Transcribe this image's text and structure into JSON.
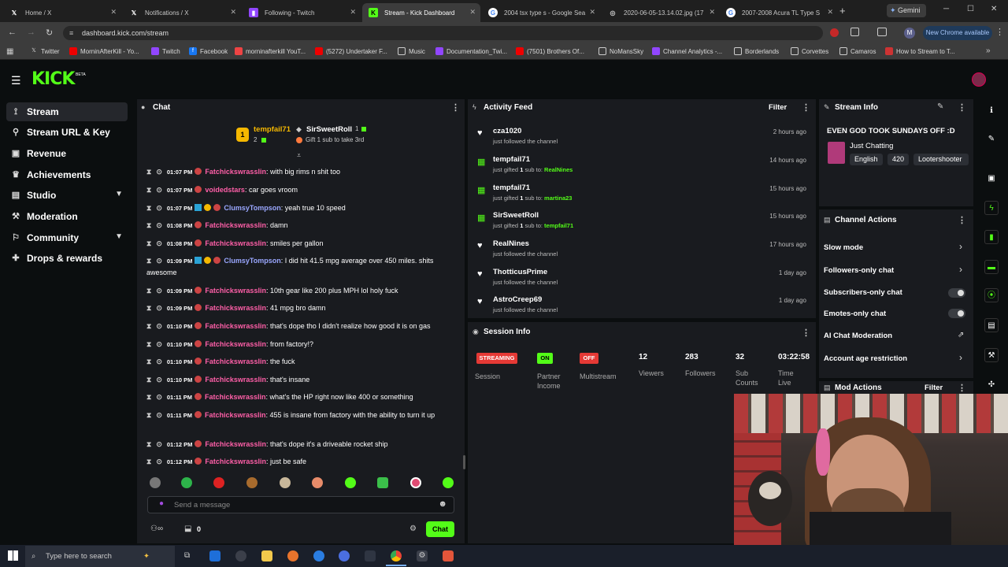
{
  "browser": {
    "tabs": [
      {
        "title": "Home / X",
        "icon": "x-logo-icon"
      },
      {
        "title": "Notifications / X",
        "icon": "x-logo-icon"
      },
      {
        "title": "Following - Twitch",
        "icon": "twitch-icon"
      },
      {
        "title": "Stream - Kick Dashboard",
        "icon": "kick-icon"
      },
      {
        "title": "2004 tsx type s - Google Sea",
        "icon": "google-icon"
      },
      {
        "title": "2020-06-05-13.14.02.jpg (17",
        "icon": "image-icon"
      },
      {
        "title": "2007-2008 Acura TL Type S",
        "icon": "google-icon"
      }
    ],
    "gemini_label": "Gemini",
    "url": "dashboard.kick.com/stream",
    "profile_initial": "M",
    "new_chrome_label": "New Chrome available",
    "bookmarks": [
      "Twitter",
      "MorninAfterKill - Yo...",
      "Twitch",
      "Facebook",
      "morninafterkill YouT...",
      "(5272) Undertaker F...",
      "Music",
      "Documentation_Twi...",
      "(7501) Brothers Of...",
      "NoMansSky",
      "Channel Analytics -...",
      "Borderlands",
      "Corvettes",
      "Camaros",
      "How to Stream to T..."
    ]
  },
  "app": {
    "logo": "KICK",
    "logo_badge": "BETA",
    "nav": [
      {
        "label": "Stream",
        "icon": "broadcast-icon",
        "active": true
      },
      {
        "label": "Stream URL & Key",
        "icon": "link-icon"
      },
      {
        "label": "Revenue",
        "icon": "revenue-icon"
      },
      {
        "label": "Achievements",
        "icon": "trophy-icon"
      },
      {
        "label": "Studio",
        "icon": "studio-icon",
        "expandable": true
      },
      {
        "label": "Moderation",
        "icon": "wrench-icon"
      },
      {
        "label": "Community",
        "icon": "community-icon",
        "expandable": true
      },
      {
        "label": "Drops & rewards",
        "icon": "gift-icon"
      }
    ]
  },
  "chat": {
    "title": "Chat",
    "leaderboard": {
      "first_name": "tempfail71",
      "first_rank": "1",
      "first_count": "2",
      "second_name": "SirSweetRoll",
      "second_count": "1",
      "gift_prompt": "Gift 1 sub to take 3rd"
    },
    "messages": [
      {
        "time": "01:07 PM",
        "user": "Fatchickswrasslin",
        "text": ": with big rims n shit too"
      },
      {
        "time": "01:07 PM",
        "user": "voidedstars",
        "text": ": car goes vroom"
      },
      {
        "time": "01:07 PM",
        "user": "ClumsyTompson",
        "text": ": yeah true 10 speed"
      },
      {
        "time": "01:08 PM",
        "user": "Fatchickswrasslin",
        "text": ": damn"
      },
      {
        "time": "01:08 PM",
        "user": "Fatchickswrasslin",
        "text": ": smiles per gallon"
      },
      {
        "time": "01:09 PM",
        "user": "ClumsyTompson",
        "text": ": I did hit 41.5 mpg average over 450 miles. shits awesome"
      },
      {
        "time": "01:09 PM",
        "user": "Fatchickswrasslin",
        "text": ": 10th gear like 200 plus MPH lol holy fuck"
      },
      {
        "time": "01:09 PM",
        "user": "Fatchickswrasslin",
        "text": ": 41 mpg bro damn"
      },
      {
        "time": "01:10 PM",
        "user": "Fatchickswrasslin",
        "text": ": that's dope tho I didn't realize how good it is on gas"
      },
      {
        "time": "01:10 PM",
        "user": "Fatchickswrasslin",
        "text": ": from factory!?"
      },
      {
        "time": "01:10 PM",
        "user": "Fatchickswrasslin",
        "text": ": the fuck"
      },
      {
        "time": "01:10 PM",
        "user": "Fatchickswrasslin",
        "text": ": that's insane"
      },
      {
        "time": "01:11 PM",
        "user": "Fatchickswrasslin",
        "text": ": what's the HP right now like 400 or something"
      },
      {
        "time": "01:11 PM",
        "user": "Fatchickswrasslin",
        "text": ": 455 is insane from factory with the ability to turn it up"
      },
      {
        "time": "01:12 PM",
        "user": "Fatchickswrasslin",
        "text": ": that's dope it's a driveable rocket ship"
      },
      {
        "time": "01:12 PM",
        "user": "Fatchickswrasslin",
        "text": ": just be safe"
      }
    ],
    "input_placeholder": "Send a message",
    "points_value": "0",
    "send_label": "Chat"
  },
  "activity": {
    "title": "Activity Feed",
    "filter_label": "Filter",
    "items": [
      {
        "name": "cza1020",
        "action": "just followed the channel",
        "time": "2 hours ago",
        "type": "follow"
      },
      {
        "name": "tempfail71",
        "action_pre": "just gifted ",
        "count": "1",
        "action_mid": " sub to: ",
        "target": "RealNines",
        "time": "14 hours ago",
        "type": "gift"
      },
      {
        "name": "tempfail71",
        "action_pre": "just gifted ",
        "count": "1",
        "action_mid": " sub to: ",
        "target": "martina23",
        "time": "15 hours ago",
        "type": "gift"
      },
      {
        "name": "SirSweetRoll",
        "action_pre": "just gifted ",
        "count": "1",
        "action_mid": " sub to: ",
        "target": "tempfail71",
        "time": "15 hours ago",
        "type": "gift"
      },
      {
        "name": "RealNines",
        "action": "just followed the channel",
        "time": "17 hours ago",
        "type": "follow"
      },
      {
        "name": "ThotticusPrime",
        "action": "just followed the channel",
        "time": "1 day ago",
        "type": "follow"
      },
      {
        "name": "AstroCreep69",
        "action": "just followed the channel",
        "time": "1 day ago",
        "type": "follow"
      }
    ]
  },
  "session": {
    "title": "Session Info",
    "streaming_badge": "STREAMING",
    "session_label": "Session",
    "partner_badge": "ON",
    "partner_label": "Partner Income",
    "multistream_badge": "OFF",
    "multistream_label": "Multistream",
    "viewers": "12",
    "viewers_label": "Viewers",
    "followers": "283",
    "followers_label": "Followers",
    "subs": "32",
    "subs_label": "Sub Counts",
    "time": "03:22:58",
    "time_label": "Time Live"
  },
  "stream_info": {
    "title": "Stream Info",
    "stream_title": "EVEN GOD TOOK SUNDAYS OFF :D",
    "category": "Just Chatting",
    "tags": [
      "English",
      "420",
      "Lootershooter"
    ]
  },
  "channel_actions": {
    "title": "Channel Actions",
    "items": [
      {
        "label": "Slow mode",
        "control": "chevron"
      },
      {
        "label": "Followers-only chat",
        "control": "chevron"
      },
      {
        "label": "Subscribers-only chat",
        "control": "toggle"
      },
      {
        "label": "Emotes-only chat",
        "control": "toggle"
      },
      {
        "label": "AI Chat Moderation",
        "control": "external"
      },
      {
        "label": "Account age restriction",
        "control": "chevron"
      }
    ]
  },
  "mod_actions": {
    "title": "Mod Actions",
    "filter_label": "Filter"
  },
  "taskbar": {
    "search_placeholder": "Type here to search"
  },
  "colors": {
    "accent": "#53fc18",
    "panel": "#191b1f",
    "username": "#ff5fa8",
    "streaming": "#e53935"
  }
}
